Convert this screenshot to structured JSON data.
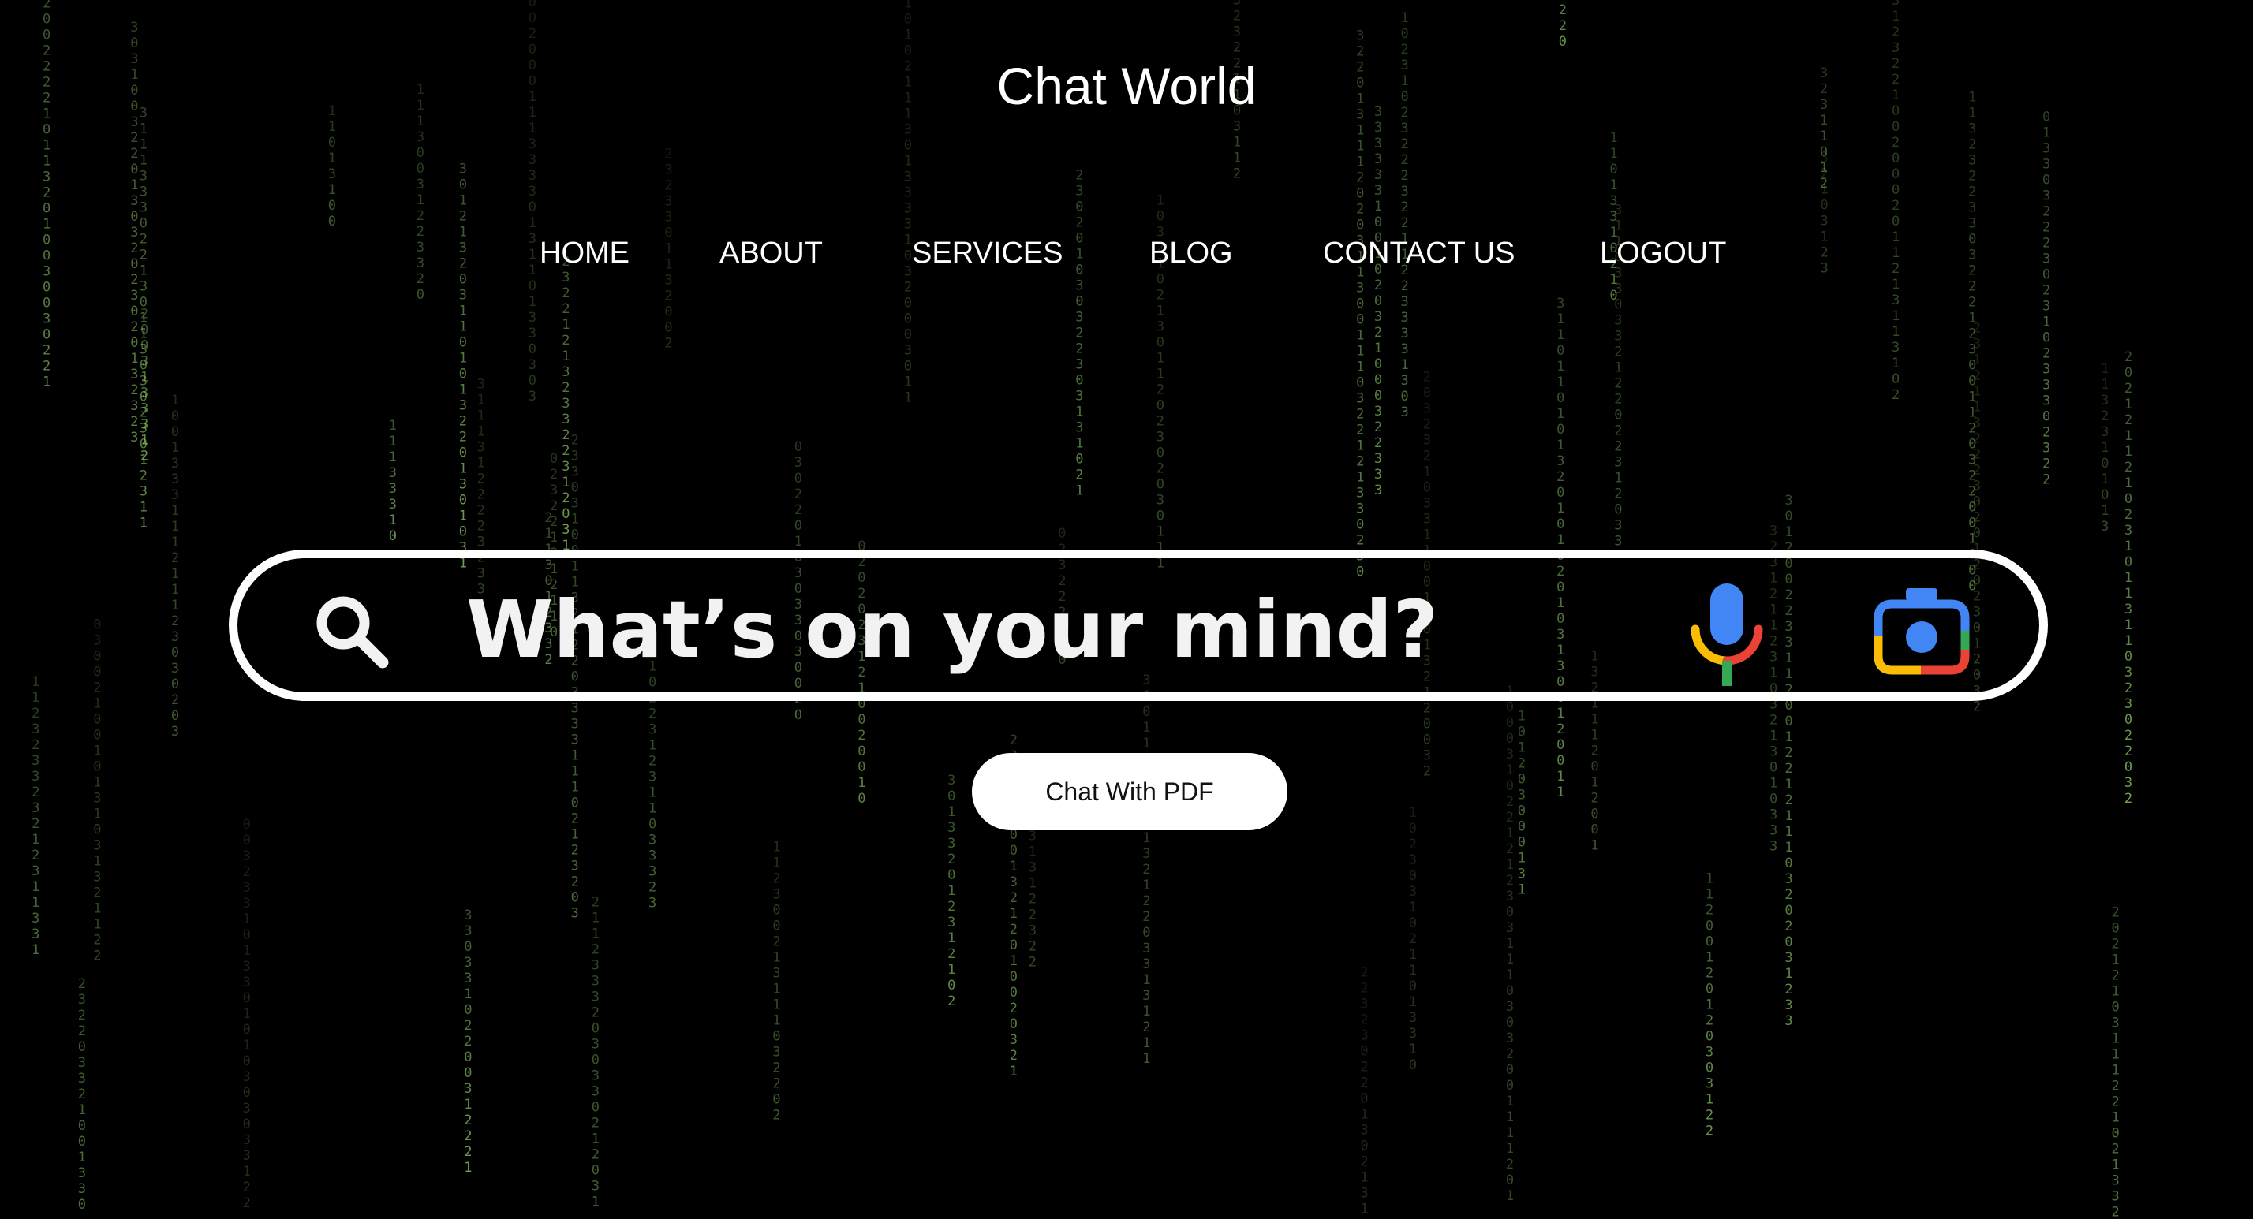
{
  "site": {
    "title": "Chat World"
  },
  "nav": {
    "items": [
      {
        "label": "HOME"
      },
      {
        "label": "ABOUT"
      },
      {
        "label": "SERVICES"
      },
      {
        "label": "BLOG"
      },
      {
        "label": "CONTACT US"
      },
      {
        "label": "LOGOUT"
      }
    ]
  },
  "search": {
    "placeholder": "What’s on your mind?",
    "value": "",
    "icons": {
      "left": "search-icon",
      "voice": "mic-icon",
      "lens": "camera-icon"
    }
  },
  "actions": {
    "pdf_button_label": "Chat With PDF"
  },
  "background": {
    "style": "matrix-digital-rain",
    "glyph_color": "#8fd16a",
    "glyphs": [
      "0",
      "1",
      "2",
      "3"
    ]
  },
  "colors": {
    "page_background": "#000000",
    "text": "#ffffff",
    "google_blue": "#4285F4",
    "google_red": "#EA4335",
    "google_yellow": "#FBBC05",
    "google_green": "#34A853"
  }
}
